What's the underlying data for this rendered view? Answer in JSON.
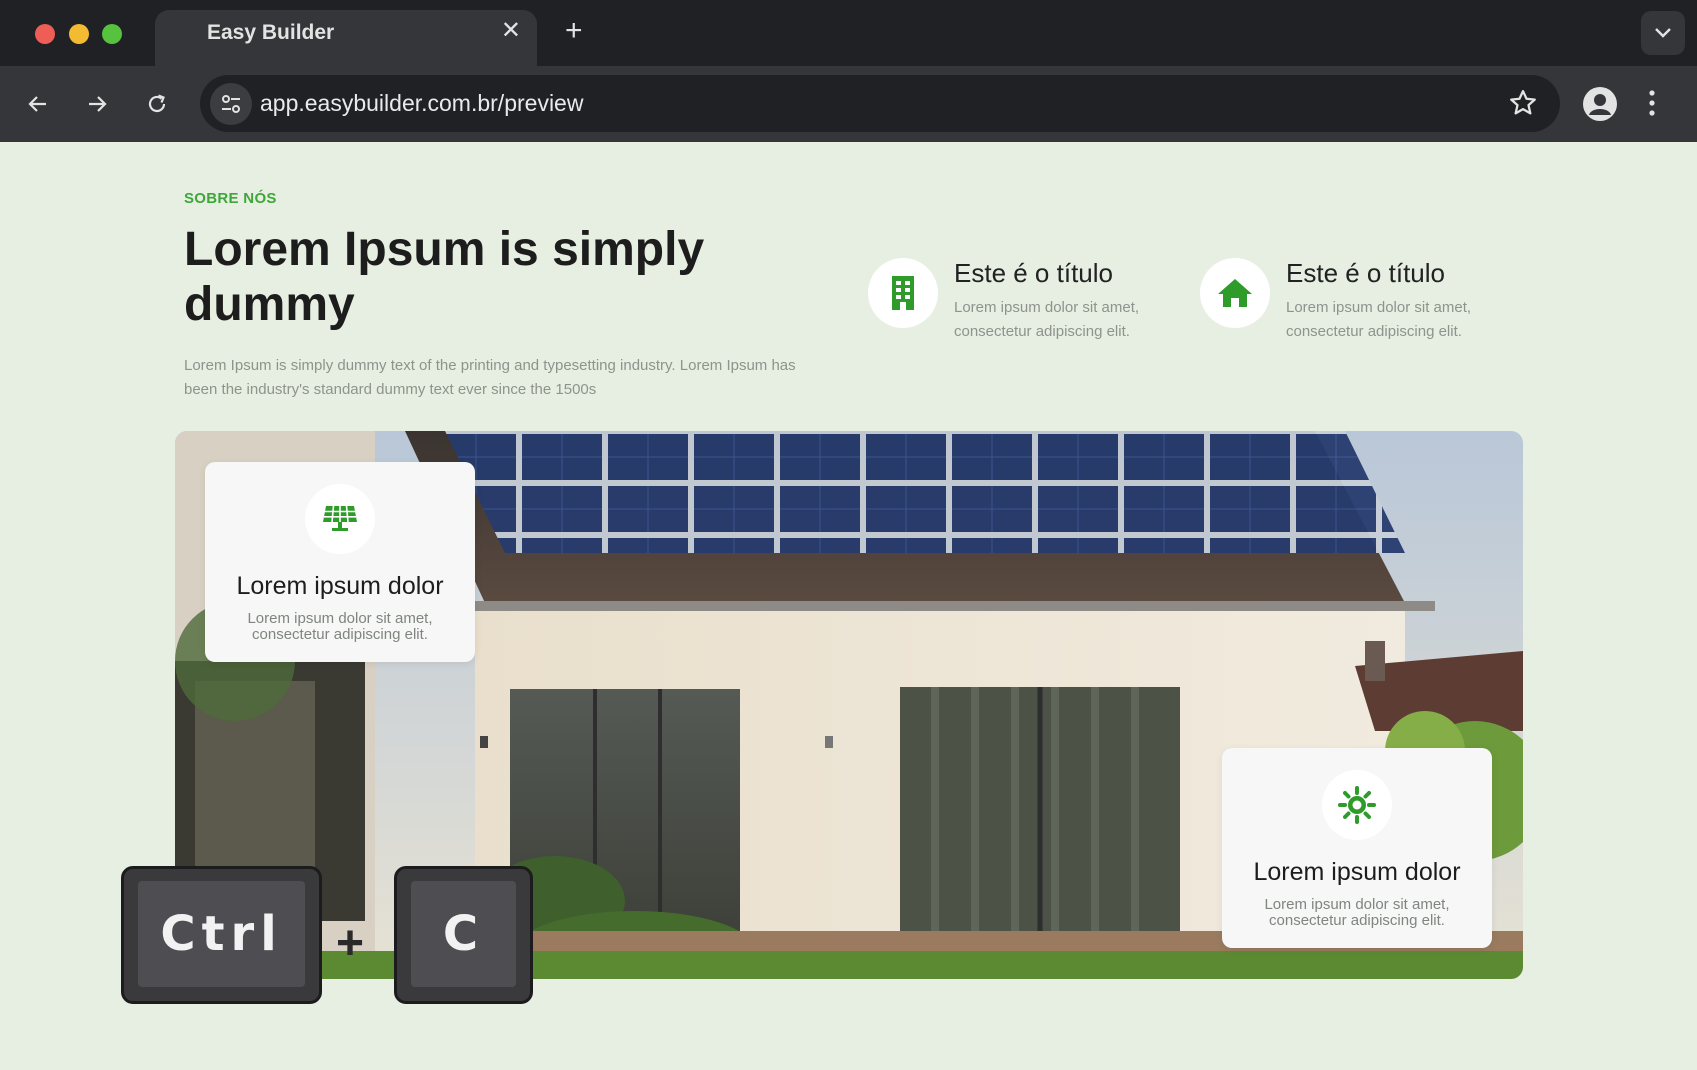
{
  "browser": {
    "tab_title": "Easy Builder",
    "tab_close": "✕",
    "new_tab": "+",
    "url": "app.easybuilder.com.br/preview"
  },
  "section": {
    "eyebrow": "SOBRE NÓS",
    "heading": "Lorem Ipsum is simply dummy",
    "lead": "Lorem Ipsum is simply dummy text of the printing and typesetting industry. Lorem Ipsum has been the industry's standard dummy text ever since the 1500s",
    "features": [
      {
        "icon": "building-icon",
        "title": "Este é o título",
        "desc": "Lorem ipsum dolor sit amet, consectetur adipiscing elit."
      },
      {
        "icon": "home-icon",
        "title": "Este é o título",
        "desc": "Lorem ipsum dolor sit amet, consectetur adipiscing elit."
      }
    ],
    "cards": [
      {
        "icon": "solar-panel-icon",
        "title": "Lorem ipsum dolor",
        "desc": "Lorem ipsum dolor sit amet, consectetur adipiscing elit."
      },
      {
        "icon": "sun-icon",
        "title": "Lorem ipsum dolor",
        "desc": "Lorem ipsum dolor sit amet, consectetur adipiscing elit."
      }
    ]
  },
  "keys": {
    "ctrl": "Ctrl",
    "plus": "+",
    "c": "C"
  },
  "colors": {
    "accent": "#3fa63a",
    "page_bg": "#e6efe2",
    "chrome_dark": "#202124",
    "chrome_mid": "#35363a"
  }
}
